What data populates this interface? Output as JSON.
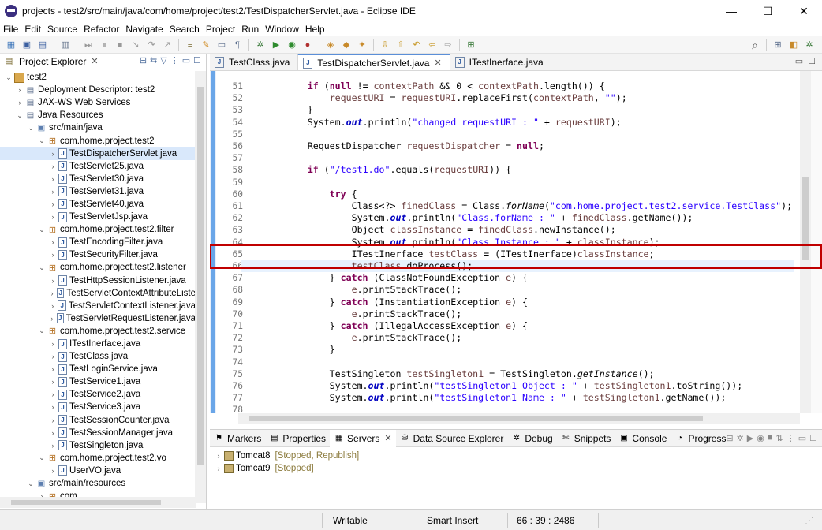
{
  "window": {
    "title": "projects - test2/src/main/java/com/home/project/test2/TestDispatcherServlet.java - Eclipse IDE",
    "minimize": "—",
    "maximize": "☐",
    "close": "✕"
  },
  "menu": [
    "File",
    "Edit",
    "Source",
    "Refactor",
    "Navigate",
    "Search",
    "Project",
    "Run",
    "Window",
    "Help"
  ],
  "explorer": {
    "title": "Project Explorer",
    "close": "✕",
    "tree": [
      {
        "label": "test2",
        "twisty": "⌄",
        "icon": "project-icon"
      },
      {
        "label": "Deployment Descriptor: test2",
        "twisty": "›",
        "icon": "descriptor-icon"
      },
      {
        "label": "JAX-WS Web Services",
        "twisty": "›",
        "icon": "webservice-icon"
      },
      {
        "label": "Java Resources",
        "twisty": "⌄",
        "icon": "java-resources-icon"
      },
      {
        "label": "src/main/java",
        "twisty": "⌄",
        "icon": "source-folder-icon"
      },
      {
        "label": "com.home.project.test2",
        "twisty": "⌄",
        "icon": "package-icon"
      },
      {
        "label": "TestDispatcherServlet.java",
        "twisty": "›",
        "icon": "java-file-icon"
      },
      {
        "label": "TestServlet25.java",
        "twisty": "›",
        "icon": "java-file-icon"
      },
      {
        "label": "TestServlet30.java",
        "twisty": "›",
        "icon": "java-file-icon"
      },
      {
        "label": "TestServlet31.java",
        "twisty": "›",
        "icon": "java-file-icon"
      },
      {
        "label": "TestServlet40.java",
        "twisty": "›",
        "icon": "java-file-icon"
      },
      {
        "label": "TestServletJsp.java",
        "twisty": "›",
        "icon": "java-file-icon"
      },
      {
        "label": "com.home.project.test2.filter",
        "twisty": "⌄",
        "icon": "package-icon"
      },
      {
        "label": "TestEncodingFilter.java",
        "twisty": "›",
        "icon": "java-file-icon"
      },
      {
        "label": "TestSecurityFilter.java",
        "twisty": "›",
        "icon": "java-file-icon"
      },
      {
        "label": "com.home.project.test2.listener",
        "twisty": "⌄",
        "icon": "package-icon"
      },
      {
        "label": "TestHttpSessionListener.java",
        "twisty": "›",
        "icon": "java-file-icon"
      },
      {
        "label": "TestServletContextAttributeListe",
        "twisty": "›",
        "icon": "java-file-icon"
      },
      {
        "label": "TestServletContextListener.java",
        "twisty": "›",
        "icon": "java-file-icon"
      },
      {
        "label": "TestServletRequestListener.java",
        "twisty": "›",
        "icon": "java-file-icon"
      },
      {
        "label": "com.home.project.test2.service",
        "twisty": "⌄",
        "icon": "package-icon"
      },
      {
        "label": "ITestInerface.java",
        "twisty": "›",
        "icon": "java-file-icon"
      },
      {
        "label": "TestClass.java",
        "twisty": "›",
        "icon": "java-file-icon"
      },
      {
        "label": "TestLoginService.java",
        "twisty": "›",
        "icon": "java-file-icon"
      },
      {
        "label": "TestService1.java",
        "twisty": "›",
        "icon": "java-file-icon"
      },
      {
        "label": "TestService2.java",
        "twisty": "›",
        "icon": "java-file-icon"
      },
      {
        "label": "TestService3.java",
        "twisty": "›",
        "icon": "java-file-icon"
      },
      {
        "label": "TestSessionCounter.java",
        "twisty": "›",
        "icon": "java-file-icon"
      },
      {
        "label": "TestSessionManager.java",
        "twisty": "›",
        "icon": "java-file-icon"
      },
      {
        "label": "TestSingleton.java",
        "twisty": "›",
        "icon": "java-file-icon"
      },
      {
        "label": "com.home.project.test2.vo",
        "twisty": "⌄",
        "icon": "package-icon"
      },
      {
        "label": "UserVO.java",
        "twisty": "›",
        "icon": "java-file-icon"
      },
      {
        "label": "src/main/resources",
        "twisty": "⌄",
        "icon": "source-folder-icon"
      },
      {
        "label": "com",
        "twisty": "›",
        "icon": "package-icon"
      }
    ]
  },
  "editor": {
    "tabs": [
      {
        "label": "TestClass.java",
        "close": ""
      },
      {
        "label": "TestDispatcherServlet.java",
        "close": "✕"
      },
      {
        "label": "ITestInerface.java",
        "close": ""
      }
    ],
    "lines": [
      {
        "n": "51",
        "parts": [
          [
            "t",
            "            "
          ],
          [
            "kw",
            "if"
          ],
          [
            "t",
            " ("
          ],
          [
            "kw",
            "null"
          ],
          [
            "t",
            " != "
          ],
          [
            "var",
            "contextPath"
          ],
          [
            "t",
            " && 0 < "
          ],
          [
            "var",
            "contextPath"
          ],
          [
            "t",
            ".length()) {"
          ]
        ]
      },
      {
        "n": "52",
        "parts": [
          [
            "t",
            "                "
          ],
          [
            "var",
            "requestURI"
          ],
          [
            "t",
            " = "
          ],
          [
            "var",
            "requestURI"
          ],
          [
            "t",
            ".replaceFirst("
          ],
          [
            "var",
            "contextPath"
          ],
          [
            "t",
            ", "
          ],
          [
            "str",
            "\"\""
          ],
          [
            "t",
            ");"
          ]
        ]
      },
      {
        "n": "53",
        "parts": [
          [
            "t",
            "            }"
          ]
        ]
      },
      {
        "n": "54",
        "parts": [
          [
            "t",
            "            System."
          ],
          [
            "fld",
            "out"
          ],
          [
            "t",
            ".println("
          ],
          [
            "str",
            "\"changed requestURI : \""
          ],
          [
            "t",
            " + "
          ],
          [
            "var",
            "requestURI"
          ],
          [
            "t",
            ");"
          ]
        ]
      },
      {
        "n": "55",
        "parts": [
          [
            "t",
            ""
          ]
        ]
      },
      {
        "n": "56",
        "parts": [
          [
            "t",
            "            RequestDispatcher "
          ],
          [
            "var",
            "requestDispatcher"
          ],
          [
            "t",
            " = "
          ],
          [
            "kw",
            "null"
          ],
          [
            "t",
            ";"
          ]
        ]
      },
      {
        "n": "57",
        "parts": [
          [
            "t",
            ""
          ]
        ]
      },
      {
        "n": "58",
        "parts": [
          [
            "t",
            "            "
          ],
          [
            "kw",
            "if"
          ],
          [
            "t",
            " ("
          ],
          [
            "str",
            "\"/test1.do\""
          ],
          [
            "t",
            ".equals("
          ],
          [
            "var",
            "requestURI"
          ],
          [
            "t",
            ")) {"
          ]
        ]
      },
      {
        "n": "59",
        "parts": [
          [
            "t",
            ""
          ]
        ]
      },
      {
        "n": "60",
        "parts": [
          [
            "t",
            "                "
          ],
          [
            "kw",
            "try"
          ],
          [
            "t",
            " {"
          ]
        ]
      },
      {
        "n": "61",
        "parts": [
          [
            "t",
            "                    Class<?> "
          ],
          [
            "var",
            "finedClass"
          ],
          [
            "t",
            " = Class."
          ],
          [
            "ital",
            "forName"
          ],
          [
            "t",
            "("
          ],
          [
            "str",
            "\"com.home.project.test2.service.TestClass\""
          ],
          [
            "t",
            ");"
          ]
        ]
      },
      {
        "n": "62",
        "parts": [
          [
            "t",
            "                    System."
          ],
          [
            "fld",
            "out"
          ],
          [
            "t",
            ".println("
          ],
          [
            "str",
            "\"Class.forName : \""
          ],
          [
            "t",
            " + "
          ],
          [
            "var",
            "finedClass"
          ],
          [
            "t",
            ".getName());"
          ]
        ]
      },
      {
        "n": "63",
        "parts": [
          [
            "t",
            "                    Object "
          ],
          [
            "var",
            "classInstance"
          ],
          [
            "t",
            " = "
          ],
          [
            "var",
            "finedClass"
          ],
          [
            "t",
            ".newInstance();"
          ]
        ]
      },
      {
        "n": "64",
        "parts": [
          [
            "t",
            "                    System."
          ],
          [
            "fld",
            "out"
          ],
          [
            "t",
            ".println("
          ],
          [
            "str",
            "\"Class Instance : \""
          ],
          [
            "t",
            " + "
          ],
          [
            "var",
            "classInstance"
          ],
          [
            "t",
            ");"
          ]
        ]
      },
      {
        "n": "65",
        "parts": [
          [
            "t",
            "                    ITestInerface "
          ],
          [
            "var",
            "testClass"
          ],
          [
            "t",
            " = (ITestInerface)"
          ],
          [
            "var",
            "classInstance"
          ],
          [
            "t",
            ";"
          ]
        ]
      },
      {
        "n": "66",
        "parts": [
          [
            "t",
            "                    "
          ],
          [
            "var",
            "testClass"
          ],
          [
            "t",
            ".doProcess();"
          ]
        ]
      },
      {
        "n": "67",
        "parts": [
          [
            "t",
            "                } "
          ],
          [
            "kw",
            "catch"
          ],
          [
            "t",
            " (ClassNotFoundException "
          ],
          [
            "var",
            "e"
          ],
          [
            "t",
            ") {"
          ]
        ]
      },
      {
        "n": "68",
        "parts": [
          [
            "t",
            "                    "
          ],
          [
            "var",
            "e"
          ],
          [
            "t",
            ".printStackTrace();"
          ]
        ]
      },
      {
        "n": "69",
        "parts": [
          [
            "t",
            "                } "
          ],
          [
            "kw",
            "catch"
          ],
          [
            "t",
            " (InstantiationException "
          ],
          [
            "var",
            "e"
          ],
          [
            "t",
            ") {"
          ]
        ]
      },
      {
        "n": "70",
        "parts": [
          [
            "t",
            "                    "
          ],
          [
            "var",
            "e"
          ],
          [
            "t",
            ".printStackTrace();"
          ]
        ]
      },
      {
        "n": "71",
        "parts": [
          [
            "t",
            "                } "
          ],
          [
            "kw",
            "catch"
          ],
          [
            "t",
            " (IllegalAccessException "
          ],
          [
            "var",
            "e"
          ],
          [
            "t",
            ") {"
          ]
        ]
      },
      {
        "n": "72",
        "parts": [
          [
            "t",
            "                    "
          ],
          [
            "var",
            "e"
          ],
          [
            "t",
            ".printStackTrace();"
          ]
        ]
      },
      {
        "n": "73",
        "parts": [
          [
            "t",
            "                }"
          ]
        ]
      },
      {
        "n": "74",
        "parts": [
          [
            "t",
            ""
          ]
        ]
      },
      {
        "n": "75",
        "parts": [
          [
            "t",
            "                TestSingleton "
          ],
          [
            "var",
            "testSingleton1"
          ],
          [
            "t",
            " = TestSingleton."
          ],
          [
            "ital",
            "getInstance"
          ],
          [
            "t",
            "();"
          ]
        ]
      },
      {
        "n": "76",
        "parts": [
          [
            "t",
            "                System."
          ],
          [
            "fld",
            "out"
          ],
          [
            "t",
            ".println("
          ],
          [
            "str",
            "\"testSingleton1 Object : \""
          ],
          [
            "t",
            " + "
          ],
          [
            "var",
            "testSingleton1"
          ],
          [
            "t",
            ".toString());"
          ]
        ]
      },
      {
        "n": "77",
        "parts": [
          [
            "t",
            "                System."
          ],
          [
            "fld",
            "out"
          ],
          [
            "t",
            ".println("
          ],
          [
            "str",
            "\"testSingleton1 Name : \""
          ],
          [
            "t",
            " + "
          ],
          [
            "var",
            "testSingleton1"
          ],
          [
            "t",
            ".getName());"
          ]
        ]
      },
      {
        "n": "78",
        "parts": [
          [
            "t",
            ""
          ]
        ]
      }
    ]
  },
  "bottom": {
    "tabs": [
      {
        "label": "Markers",
        "icon": "markers-icon",
        "glyph": "⚑"
      },
      {
        "label": "Properties",
        "icon": "properties-icon",
        "glyph": "▤"
      },
      {
        "label": "Servers",
        "icon": "servers-icon",
        "glyph": "▦",
        "close": "✕"
      },
      {
        "label": "Data Source Explorer",
        "icon": "database-icon",
        "glyph": "⛁"
      },
      {
        "label": "Debug",
        "icon": "debug-icon",
        "glyph": "✲"
      },
      {
        "label": "Snippets",
        "icon": "snippets-icon",
        "glyph": "✄"
      },
      {
        "label": "Console",
        "icon": "console-icon",
        "glyph": "▣"
      },
      {
        "label": "Progress",
        "icon": "progress-icon",
        "glyph": "◔"
      }
    ],
    "servers": [
      {
        "name": "Tomcat8",
        "status": "[Stopped, Republish]"
      },
      {
        "name": "Tomcat9",
        "status": "[Stopped]"
      }
    ]
  },
  "status": {
    "mode": "Writable",
    "insert": "Smart Insert",
    "position": "66 : 39 : 2486"
  },
  "colors": {
    "keyword": "#7f0055",
    "string": "#2a00ff",
    "field": "#0000c0",
    "local": "#6a3e3e",
    "highlight_border": "#c00000"
  }
}
